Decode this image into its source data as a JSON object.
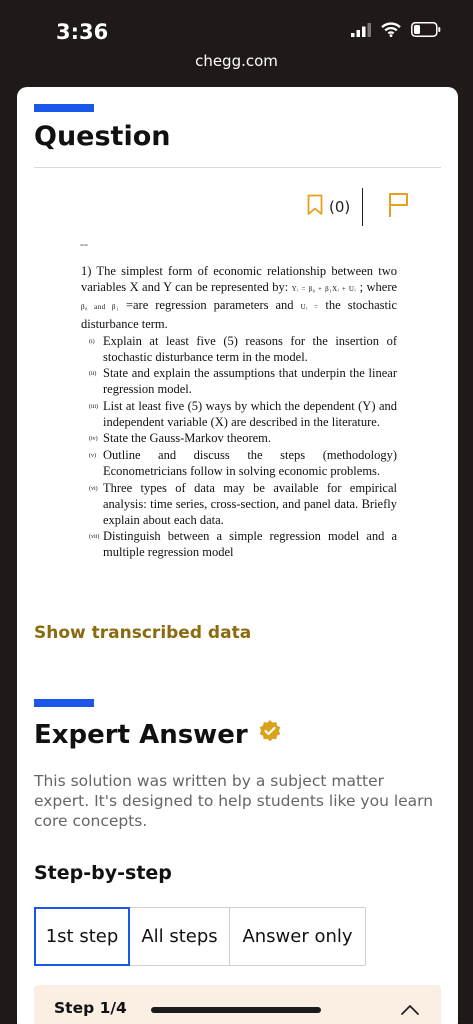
{
  "status": {
    "time": "3:36"
  },
  "browser": {
    "url": "chegg.com"
  },
  "question": {
    "heading": "Question",
    "bookmark_count": "(0)",
    "dash": "--",
    "intro_a": "1) The simplest form of economic relationship between two variables X and Y can be represented by:",
    "equation": "Yᵢ = β₀ + β₁Xᵢ + Uᵢ",
    "intro_b": "; where",
    "params": "β₀ and β₁",
    "intro_c": "=are regression parameters and",
    "u_term": "Uᵢ =",
    "intro_d": "the stochastic disturbance term.",
    "items": [
      {
        "num": "(i)",
        "text": "Explain at least five (5) reasons for the insertion of stochastic disturbance term in the model."
      },
      {
        "num": "(ii)",
        "text": "State and explain the assumptions that underpin the linear regression model."
      },
      {
        "num": "(iii)",
        "text": "List at least five (5) ways by which the dependent (Y) and independent variable (X) are described in the literature."
      },
      {
        "num": "(iv)",
        "text": "State the Gauss-Markov theorem."
      },
      {
        "num": "(v)",
        "text": "Outline and discuss the steps (methodology) Econometricians follow in solving economic problems."
      },
      {
        "num": "(vi)",
        "text": "Three types of data may be available for empirical analysis: time series, cross-section, and panel data. Briefly explain about each data."
      },
      {
        "num": "(vii)",
        "text": "Distinguish between a simple regression model and a multiple regression model"
      }
    ],
    "show_transcribed": "Show transcribed data"
  },
  "answer": {
    "heading": "Expert Answer",
    "description": "This solution was written by a subject matter expert. It's designed to help students like you learn core concepts.",
    "step_heading": "Step-by-step",
    "tabs": [
      "1st step",
      "All steps",
      "Answer only"
    ],
    "active_tab": "1st step",
    "step_label": "Step 1/4",
    "progress_fraction": 0.25
  },
  "colors": {
    "accent": "#1a57e8",
    "link": "#8b6a10",
    "flag": "#e8a020",
    "verified": "#d9a21b",
    "step_bg": "#fbeee2"
  },
  "icons": [
    "signal-icon",
    "wifi-icon",
    "battery-icon",
    "bookmark-icon",
    "flag-icon",
    "verified-badge-icon",
    "chevron-up-icon"
  ]
}
